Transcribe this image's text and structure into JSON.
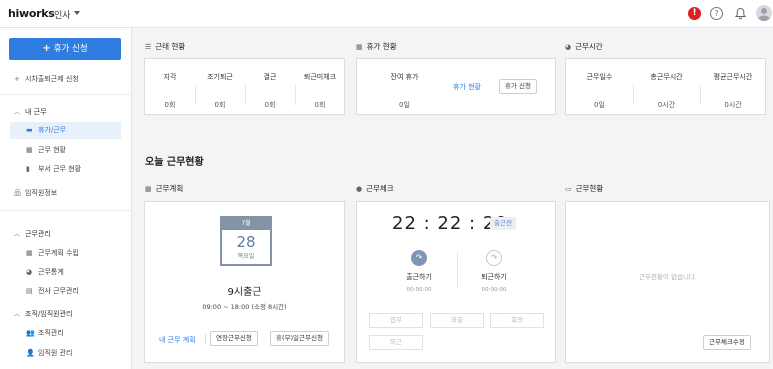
{
  "header": {
    "logo": "hiworks",
    "app_name": "인사",
    "alert_badge": "!",
    "help_icon": "?"
  },
  "sidebar": {
    "primary_button": "휴가 신청",
    "apply_link": "시차출퇴근제 신청",
    "sections": [
      {
        "title": "내 근무",
        "items": [
          {
            "label": "휴가/근무",
            "active": true
          },
          {
            "label": "근무 현황"
          },
          {
            "label": "부서 근무 현황"
          }
        ]
      },
      {
        "title": "임직원정보"
      },
      {
        "title": "근무관리",
        "items": [
          {
            "label": "근무계획 수립"
          },
          {
            "label": "근무통계"
          },
          {
            "label": "전사 근무관리"
          }
        ]
      },
      {
        "title": "조직/임직원관리",
        "items": [
          {
            "label": "조직관리"
          },
          {
            "label": "임직원 관리"
          }
        ]
      }
    ]
  },
  "attendance": {
    "title": "근태 현황",
    "stats": [
      {
        "label": "지각",
        "value": "0회"
      },
      {
        "label": "조기퇴근",
        "value": "0회"
      },
      {
        "label": "결근",
        "value": "0회"
      },
      {
        "label": "퇴근미체크",
        "value": "0회"
      }
    ]
  },
  "leave": {
    "title": "휴가 현황",
    "remaining_label": "잔여 휴가",
    "remaining_value": "0일",
    "status_link": "휴가 현황",
    "apply_button": "휴가 신청"
  },
  "worktime": {
    "title": "근무시간",
    "stats": [
      {
        "label": "근무일수",
        "value": "0일"
      },
      {
        "label": "총근무시간",
        "value": "0시간"
      },
      {
        "label": "평균근무시간",
        "value": "0시간"
      }
    ]
  },
  "today": {
    "heading": "오늘 근무현황",
    "plan": {
      "title": "근무계획",
      "calendar_month": "7월",
      "calendar_day": "28",
      "calendar_weekday": "목요일",
      "shift_title": "9시출근",
      "shift_hours": "09:00 ~ 18:00 (소정 8시간)",
      "my_plan_link": "내 근무 계획",
      "overtime_button": "연장근무신청",
      "holiday_button": "휴(무)일근무신청"
    },
    "check": {
      "title": "근무체크",
      "clock": "22 : 22 : 20",
      "status_badge": "출근전",
      "in_label": "출근하기",
      "in_time": "00:00:00",
      "out_label": "퇴근하기",
      "out_time": "00:00:00",
      "buttons": [
        "업무",
        "외출",
        "회의",
        "외근"
      ]
    },
    "status": {
      "title": "근무현황",
      "empty_text": "근무현황이 없습니다.",
      "edit_button": "근무체크수정"
    }
  }
}
